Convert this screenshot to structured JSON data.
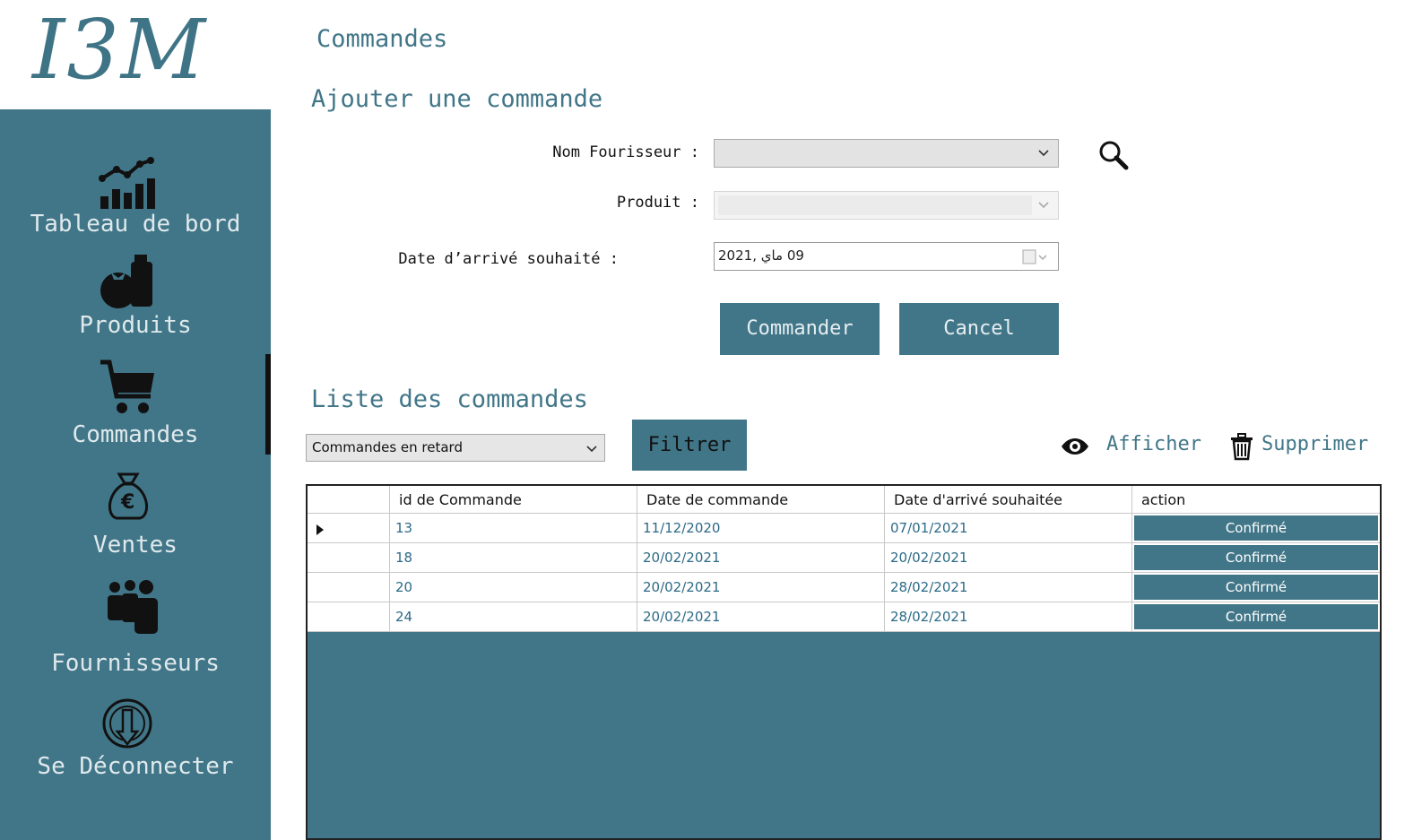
{
  "app": {
    "logo": "I3M"
  },
  "sidebar": {
    "items": [
      {
        "label": "Tableau de bord",
        "icon": "chart-icon"
      },
      {
        "label": "Produits",
        "icon": "grocery-icon"
      },
      {
        "label": "Commandes",
        "icon": "cart-icon"
      },
      {
        "label": "Ventes",
        "icon": "money-bag-icon"
      },
      {
        "label": "Fournisseurs",
        "icon": "people-icon"
      },
      {
        "label": "Se Déconnecter",
        "icon": "logout-icon"
      }
    ],
    "active": "Commandes"
  },
  "page": {
    "title": "Commandes"
  },
  "form": {
    "title": "Ajouter une commande",
    "supplier_label": "Nom Fourisseur :",
    "supplier_value": "",
    "product_label": "Produit :",
    "product_value": "",
    "date_label": "Date d’arrivé souhaité :",
    "date_value": "09  ماي  ,2021",
    "submit_label": "Commander",
    "cancel_label": "Cancel"
  },
  "list": {
    "title": "Liste des commandes",
    "filter_value": "Commandes en retard",
    "filter_button": "Filtrer",
    "view_label": "Afficher",
    "delete_label": "Supprimer",
    "columns": [
      "id de Commande",
      "Date de commande",
      "Date d'arrivé souhaitée",
      "action"
    ],
    "rows": [
      {
        "id": "13",
        "date": "11/12/2020",
        "arrival": "07/01/2021",
        "action": "Confirmé"
      },
      {
        "id": "18",
        "date": "20/02/2021",
        "arrival": "20/02/2021",
        "action": "Confirmé"
      },
      {
        "id": "20",
        "date": "20/02/2021",
        "arrival": "28/02/2021",
        "action": "Confirmé"
      },
      {
        "id": "24",
        "date": "20/02/2021",
        "arrival": "28/02/2021",
        "action": "Confirmé"
      }
    ]
  },
  "colors": {
    "primary": "#417688",
    "link_text": "#2c6a86"
  }
}
